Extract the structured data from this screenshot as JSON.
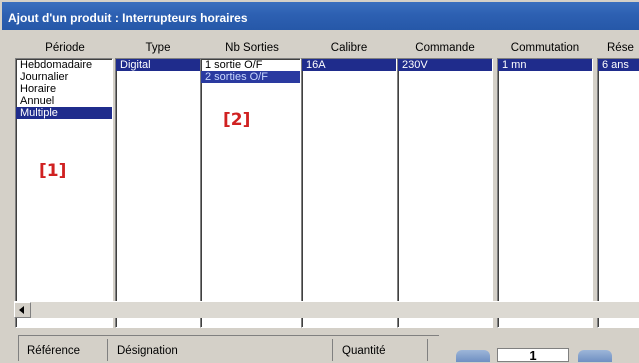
{
  "window": {
    "title": "Ajout d'un produit : Interrupteurs horaires"
  },
  "columns": [
    {
      "key": "periode",
      "header": "Période",
      "items": [
        "Hebdomadaire",
        "Journalier",
        "Horaire",
        "Annuel",
        "Multiple"
      ],
      "selected": [
        4
      ]
    },
    {
      "key": "type",
      "header": "Type",
      "items": [
        "Digital"
      ],
      "selected": [
        0
      ]
    },
    {
      "key": "nb_sorties",
      "header": "Nb Sorties",
      "items": [
        "1 sortie O/F",
        "2 sorties O/F"
      ],
      "selected": [
        1
      ]
    },
    {
      "key": "calibre",
      "header": "Calibre",
      "items": [
        "16A"
      ],
      "selected": [
        0
      ]
    },
    {
      "key": "commande",
      "header": "Commande",
      "items": [
        "230V"
      ],
      "selected": [
        0
      ]
    },
    {
      "key": "commutation",
      "header": "Commutation",
      "items": [
        "1 mn"
      ],
      "selected": [
        0
      ]
    },
    {
      "key": "reserve",
      "header": "Rése",
      "items": [
        "6 ans"
      ],
      "selected": [
        0
      ]
    }
  ],
  "markers": {
    "m1": "[1]",
    "m2": "[2]"
  },
  "bottom_table": {
    "headers": {
      "reference": "Référence",
      "designation": "Désignation",
      "quantite": "Quantité"
    }
  },
  "counter": {
    "value": "1"
  },
  "colors": {
    "title_bar": "#2d60b2",
    "selection": "#1f2c8c",
    "marker": "#d02121"
  }
}
